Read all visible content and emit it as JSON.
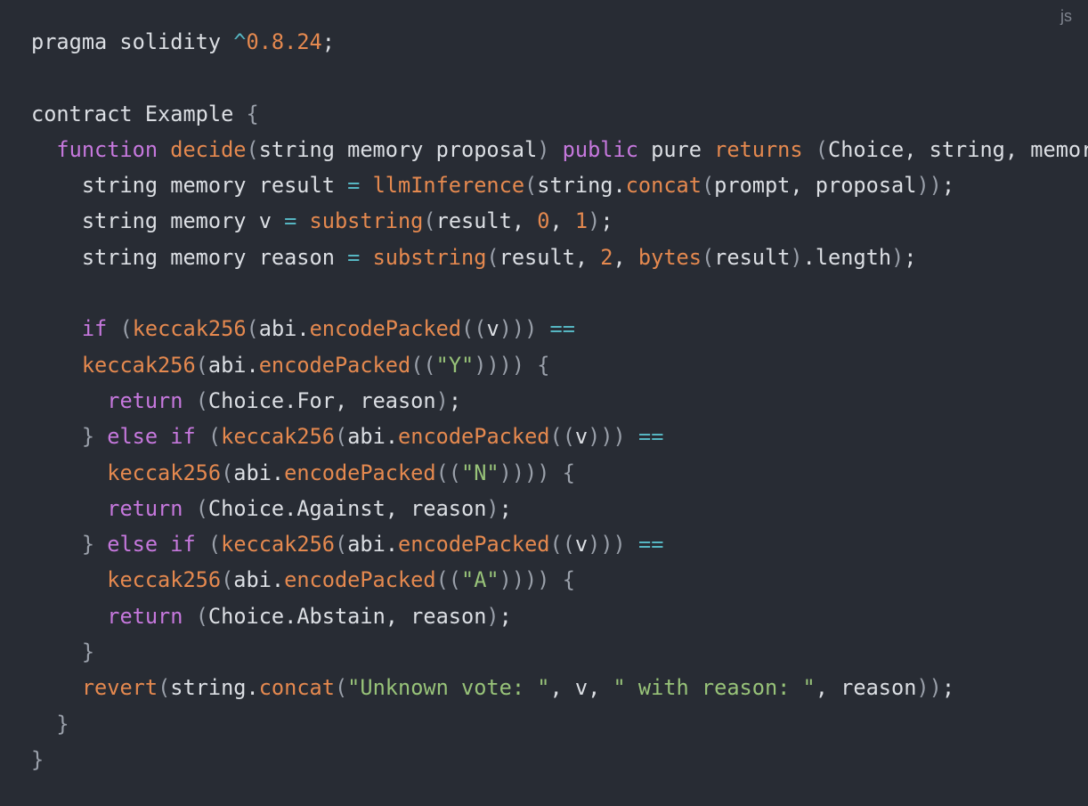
{
  "language_label": "js",
  "colors": {
    "background": "#282c34",
    "plain": "#dcdfe4",
    "keyword": "#c678dd",
    "function": "#e5894f",
    "number": "#e5894f",
    "string": "#98c379",
    "operator": "#56b6c2",
    "punct": "#9aa0aa"
  },
  "code_lines": [
    {
      "indent": "",
      "tokens": [
        [
          "plain",
          "pragma solidity "
        ],
        [
          "operator",
          "^"
        ],
        [
          "number",
          "0.8.24"
        ],
        [
          "plain",
          ";"
        ]
      ]
    },
    {
      "indent": "",
      "tokens": []
    },
    {
      "indent": "",
      "tokens": [
        [
          "plain",
          "contract Example "
        ],
        [
          "punct",
          "{"
        ]
      ]
    },
    {
      "indent": "  ",
      "tokens": [
        [
          "keyword",
          "function "
        ],
        [
          "function",
          "decide"
        ],
        [
          "punct",
          "("
        ],
        [
          "plain",
          "string memory proposal"
        ],
        [
          "punct",
          ")"
        ],
        [
          "plain",
          " "
        ],
        [
          "keyword",
          "public"
        ],
        [
          "plain",
          " pure "
        ],
        [
          "function",
          "returns"
        ],
        [
          "plain",
          " "
        ],
        [
          "punct",
          "("
        ],
        [
          "plain",
          "Choice, string, memory"
        ],
        [
          "punct",
          ")"
        ],
        [
          "plain",
          " "
        ],
        [
          "punct",
          "{"
        ]
      ]
    },
    {
      "indent": "    ",
      "tokens": [
        [
          "plain",
          "string memory result "
        ],
        [
          "operator",
          "="
        ],
        [
          "plain",
          " "
        ],
        [
          "function",
          "llmInference"
        ],
        [
          "punct",
          "("
        ],
        [
          "plain",
          "string."
        ],
        [
          "function",
          "concat"
        ],
        [
          "punct",
          "("
        ],
        [
          "plain",
          "prompt, proposal"
        ],
        [
          "punct",
          "))"
        ],
        [
          "plain",
          ";"
        ]
      ]
    },
    {
      "indent": "    ",
      "tokens": [
        [
          "plain",
          "string memory v "
        ],
        [
          "operator",
          "="
        ],
        [
          "plain",
          " "
        ],
        [
          "function",
          "substring"
        ],
        [
          "punct",
          "("
        ],
        [
          "plain",
          "result, "
        ],
        [
          "number",
          "0"
        ],
        [
          "plain",
          ", "
        ],
        [
          "number",
          "1"
        ],
        [
          "punct",
          ")"
        ],
        [
          "plain",
          ";"
        ]
      ]
    },
    {
      "indent": "    ",
      "tokens": [
        [
          "plain",
          "string memory reason "
        ],
        [
          "operator",
          "="
        ],
        [
          "plain",
          " "
        ],
        [
          "function",
          "substring"
        ],
        [
          "punct",
          "("
        ],
        [
          "plain",
          "result, "
        ],
        [
          "number",
          "2"
        ],
        [
          "plain",
          ", "
        ],
        [
          "function",
          "bytes"
        ],
        [
          "punct",
          "("
        ],
        [
          "plain",
          "result"
        ],
        [
          "punct",
          ")"
        ],
        [
          "plain",
          ".length"
        ],
        [
          "punct",
          ")"
        ],
        [
          "plain",
          ";"
        ]
      ]
    },
    {
      "indent": "",
      "tokens": []
    },
    {
      "indent": "    ",
      "tokens": [
        [
          "keyword",
          "if"
        ],
        [
          "plain",
          " "
        ],
        [
          "punct",
          "("
        ],
        [
          "function",
          "keccak256"
        ],
        [
          "punct",
          "("
        ],
        [
          "plain",
          "abi."
        ],
        [
          "function",
          "encodePacked"
        ],
        [
          "punct",
          "(("
        ],
        [
          "plain",
          "v"
        ],
        [
          "punct",
          ")))"
        ],
        [
          "plain",
          " "
        ],
        [
          "operator",
          "=="
        ]
      ]
    },
    {
      "indent": "    ",
      "tokens": [
        [
          "function",
          "keccak256"
        ],
        [
          "punct",
          "("
        ],
        [
          "plain",
          "abi."
        ],
        [
          "function",
          "encodePacked"
        ],
        [
          "punct",
          "(("
        ],
        [
          "string",
          "\"Y\""
        ],
        [
          "punct",
          "))))"
        ],
        [
          "plain",
          " "
        ],
        [
          "punct",
          "{"
        ]
      ]
    },
    {
      "indent": "      ",
      "tokens": [
        [
          "keyword",
          "return"
        ],
        [
          "plain",
          " "
        ],
        [
          "punct",
          "("
        ],
        [
          "plain",
          "Choice.For, reason"
        ],
        [
          "punct",
          ")"
        ],
        [
          "plain",
          ";"
        ]
      ]
    },
    {
      "indent": "    ",
      "tokens": [
        [
          "punct",
          "}"
        ],
        [
          "plain",
          " "
        ],
        [
          "keyword",
          "else if"
        ],
        [
          "plain",
          " "
        ],
        [
          "punct",
          "("
        ],
        [
          "function",
          "keccak256"
        ],
        [
          "punct",
          "("
        ],
        [
          "plain",
          "abi."
        ],
        [
          "function",
          "encodePacked"
        ],
        [
          "punct",
          "(("
        ],
        [
          "plain",
          "v"
        ],
        [
          "punct",
          ")))"
        ],
        [
          "plain",
          " "
        ],
        [
          "operator",
          "=="
        ]
      ]
    },
    {
      "indent": "      ",
      "tokens": [
        [
          "function",
          "keccak256"
        ],
        [
          "punct",
          "("
        ],
        [
          "plain",
          "abi."
        ],
        [
          "function",
          "encodePacked"
        ],
        [
          "punct",
          "(("
        ],
        [
          "string",
          "\"N\""
        ],
        [
          "punct",
          "))))"
        ],
        [
          "plain",
          " "
        ],
        [
          "punct",
          "{"
        ]
      ]
    },
    {
      "indent": "      ",
      "tokens": [
        [
          "keyword",
          "return"
        ],
        [
          "plain",
          " "
        ],
        [
          "punct",
          "("
        ],
        [
          "plain",
          "Choice.Against, reason"
        ],
        [
          "punct",
          ")"
        ],
        [
          "plain",
          ";"
        ]
      ]
    },
    {
      "indent": "    ",
      "tokens": [
        [
          "punct",
          "}"
        ],
        [
          "plain",
          " "
        ],
        [
          "keyword",
          "else if"
        ],
        [
          "plain",
          " "
        ],
        [
          "punct",
          "("
        ],
        [
          "function",
          "keccak256"
        ],
        [
          "punct",
          "("
        ],
        [
          "plain",
          "abi."
        ],
        [
          "function",
          "encodePacked"
        ],
        [
          "punct",
          "(("
        ],
        [
          "plain",
          "v"
        ],
        [
          "punct",
          ")))"
        ],
        [
          "plain",
          " "
        ],
        [
          "operator",
          "=="
        ]
      ]
    },
    {
      "indent": "      ",
      "tokens": [
        [
          "function",
          "keccak256"
        ],
        [
          "punct",
          "("
        ],
        [
          "plain",
          "abi."
        ],
        [
          "function",
          "encodePacked"
        ],
        [
          "punct",
          "(("
        ],
        [
          "string",
          "\"A\""
        ],
        [
          "punct",
          "))))"
        ],
        [
          "plain",
          " "
        ],
        [
          "punct",
          "{"
        ]
      ]
    },
    {
      "indent": "      ",
      "tokens": [
        [
          "keyword",
          "return"
        ],
        [
          "plain",
          " "
        ],
        [
          "punct",
          "("
        ],
        [
          "plain",
          "Choice.Abstain, reason"
        ],
        [
          "punct",
          ")"
        ],
        [
          "plain",
          ";"
        ]
      ]
    },
    {
      "indent": "    ",
      "tokens": [
        [
          "punct",
          "}"
        ]
      ]
    },
    {
      "indent": "    ",
      "tokens": [
        [
          "function",
          "revert"
        ],
        [
          "punct",
          "("
        ],
        [
          "plain",
          "string."
        ],
        [
          "function",
          "concat"
        ],
        [
          "punct",
          "("
        ],
        [
          "string",
          "\"Unknown vote: \""
        ],
        [
          "plain",
          ", v, "
        ],
        [
          "string",
          "\" with reason: \""
        ],
        [
          "plain",
          ", reason"
        ],
        [
          "punct",
          "))"
        ],
        [
          "plain",
          ";"
        ]
      ]
    },
    {
      "indent": "  ",
      "tokens": [
        [
          "punct",
          "}"
        ]
      ]
    },
    {
      "indent": "",
      "tokens": [
        [
          "punct",
          "}"
        ]
      ]
    }
  ]
}
